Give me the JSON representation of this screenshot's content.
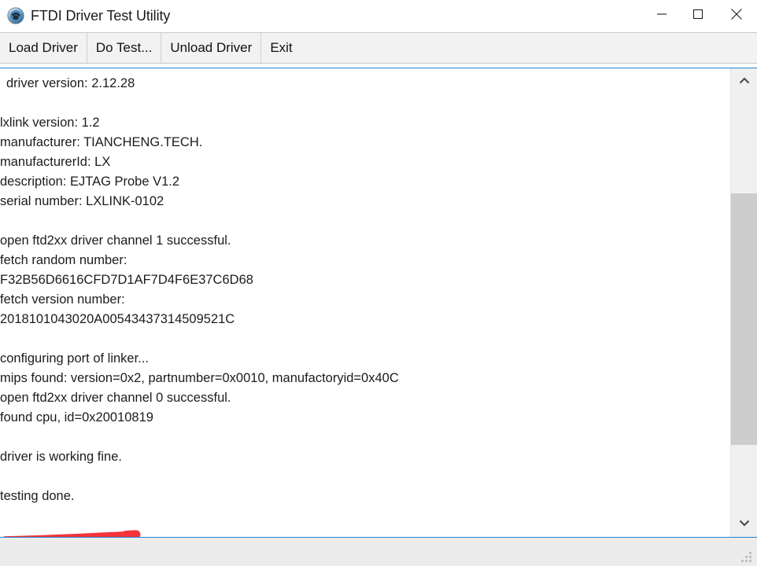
{
  "window": {
    "title": "FTDI Driver Test Utility",
    "icon": "paw-app-icon",
    "controls": {
      "minimize": "minimize-icon",
      "maximize": "maximize-icon",
      "close": "close-icon"
    }
  },
  "menu": {
    "items": [
      {
        "label": "Load Driver"
      },
      {
        "label": "Do Test..."
      },
      {
        "label": "Unload Driver"
      },
      {
        "label": "Exit"
      }
    ]
  },
  "log": {
    "lines": [
      {
        "text": "driver version: 2.12.28",
        "indented": true
      },
      {
        "text": "",
        "indented": false
      },
      {
        "text": "lxlink version: 1.2",
        "indented": false
      },
      {
        "text": "manufacturer: TIANCHENG.TECH.",
        "indented": false
      },
      {
        "text": "manufacturerId: LX",
        "indented": false
      },
      {
        "text": "description: EJTAG Probe V1.2",
        "indented": false
      },
      {
        "text": "serial number: LXLINK-0102",
        "indented": false
      },
      {
        "text": "",
        "indented": false
      },
      {
        "text": "open ftd2xx driver channel 1 successful.",
        "indented": false
      },
      {
        "text": "fetch random number:",
        "indented": false
      },
      {
        "text": "F32B56D6616CFD7D1AF7D4F6E37C6D68",
        "indented": false
      },
      {
        "text": "fetch version number:",
        "indented": false
      },
      {
        "text": "2018101043020A00543437314509521C",
        "indented": false
      },
      {
        "text": "",
        "indented": false
      },
      {
        "text": "configuring port of linker...",
        "indented": false
      },
      {
        "text": "mips found: version=0x2, partnumber=0x0010, manufactoryid=0x40C",
        "indented": false
      },
      {
        "text": "open ftd2xx driver channel 0 successful.",
        "indented": false
      },
      {
        "text": "found cpu, id=0x20010819",
        "indented": false
      },
      {
        "text": "",
        "indented": false
      },
      {
        "text": "driver is working fine.",
        "indented": false
      },
      {
        "text": "",
        "indented": false
      },
      {
        "text": "testing done.",
        "indented": false
      }
    ]
  },
  "annotation": {
    "type": "red-underline",
    "target_text": "driver is working fine.",
    "color": "#f4333c"
  },
  "scrollbar": {
    "up_arrow": "chevron-up-icon",
    "down_arrow": "chevron-down-icon"
  },
  "colors": {
    "content_border": "#1b86d4",
    "menu_background": "#f2f2f2",
    "scrollbar_thumb": "#cdcdcd",
    "annotation_red": "#f4333c"
  }
}
